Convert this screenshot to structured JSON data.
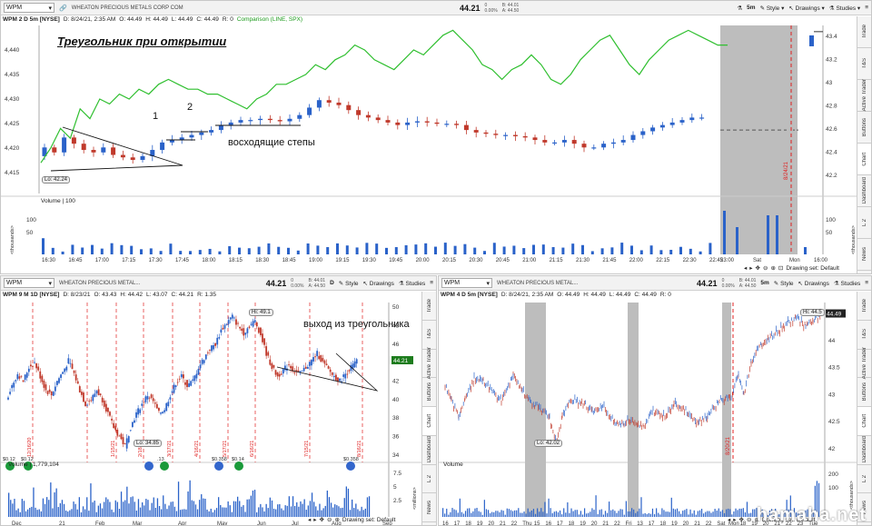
{
  "top": {
    "symbol": "WPM",
    "company": "WHEATON PRECIOUS METALS CORP COM",
    "price": "44.21",
    "change": "0",
    "change_pct": "0.00%",
    "bid": "B: 44.01",
    "ask": "A: 44.50",
    "info": {
      "title": "WPM 2 D 5m [NYSE]",
      "date": "D: 8/24/21, 2:35 AM",
      "open": "O: 44.49",
      "high": "H: 44.49",
      "low": "L: 44.49",
      "close": "C: 44.49",
      "range": "R: 0"
    },
    "comparison": "Comparison (LINE, SPX)",
    "interval": "5m",
    "style_label": "Style",
    "drawings_label": "Drawings",
    "studies_label": "Studies",
    "annotation_title": "Треугольник при открытии",
    "annotation_1": "1",
    "annotation_2": "2",
    "annotation_steps": "восходящие степы",
    "lo_label": "Lo: 42.24",
    "volume_label": "Volume",
    "volume_value": "100",
    "drawing_set": "Drawing set: Default",
    "date_marker": "8/24/21",
    "left_axis": [
      "4,440",
      "4,435",
      "4,430",
      "4,425",
      "4,420",
      "4,415"
    ],
    "right_axis": [
      "43.4",
      "43.2",
      "43",
      "42.8",
      "42.6",
      "42.4",
      "42.2"
    ],
    "vol_axis": [
      "100",
      "50"
    ],
    "thousands": "<thousands>",
    "time_axis": [
      "16:30",
      "16:45",
      "17:00",
      "17:15",
      "17:30",
      "17:45",
      "18:00",
      "18:15",
      "18:30",
      "18:45",
      "19:00",
      "19:15",
      "19:30",
      "19:45",
      "20:00",
      "20:15",
      "20:30",
      "20:45",
      "21:00",
      "21:15",
      "21:30",
      "21:45",
      "22:00",
      "22:15",
      "22:30",
      "22:45",
      "23:00",
      "Sat",
      "Mon",
      "16:00"
    ],
    "side_tabs": [
      "Trade",
      "T&S",
      "Active Trader",
      "Buttons",
      "Chart",
      "Dashboard",
      "L 2",
      "News"
    ]
  },
  "bottom_left": {
    "symbol": "WPM",
    "company": "WHEATON PRECIOUS METAL...",
    "price": "44.21",
    "change": "0",
    "change_pct": "0.00%",
    "bid": "B: 44.01",
    "ask": "A: 44.50",
    "interval": "D",
    "style_label": "Style",
    "drawings_label": "Drawings",
    "studies_label": "Studies",
    "info": {
      "title": "WPM 9 M 1D [NYSE]",
      "date": "D: 8/23/21",
      "open": "O: 43.43",
      "high": "H: 44.42",
      "low": "L: 43.07",
      "close": "C: 44.21",
      "range": "R: 1.35"
    },
    "annotation_exit": "выход из треугольника",
    "hi_label": "Hi: 49.1",
    "lo_label": "Lo: 34.85",
    "price_tag": "44.21",
    "volume_label": "Volume",
    "volume_value": "1,779,104",
    "drawing_set": "Drawing set: Default",
    "dividends": [
      "$0.12",
      "$0.12",
      ".13",
      "$0.358",
      "$0.14",
      "$0.358"
    ],
    "right_axis": [
      "50",
      "48",
      "46",
      "44",
      "42",
      "40",
      "38",
      "36",
      "34"
    ],
    "vol_axis": [
      "7.5",
      "5",
      "2.5"
    ],
    "millions": "<millions>",
    "time_axis": [
      "Dec",
      "21",
      "Feb",
      "Mar",
      "Apr",
      "May",
      "Jun",
      "Jul",
      "Aug",
      "Sep"
    ],
    "date_markers": [
      "12/16/20",
      "1/15/21",
      "2/18/21",
      "3/17/21",
      "4/16/21",
      "5/17/21",
      "6/16/21",
      "7/15/21",
      "8/16/21"
    ],
    "side_tabs": [
      "Trade",
      "T&S",
      "Active Trader",
      "Buttons",
      "Chart",
      "Dashboard",
      "L 2",
      "News"
    ]
  },
  "bottom_right": {
    "symbol": "WPM",
    "company": "WHEATON PRECIOUS METAL...",
    "price": "44.21",
    "change": "0",
    "change_pct": "0.00%",
    "bid": "B: 44.01",
    "ask": "A: 44.50",
    "interval": "5m",
    "style_label": "Style",
    "drawings_label": "Drawings",
    "studies_label": "Studies",
    "info": {
      "title": "WPM 4 D 5m [NYSE]",
      "date": "D: 8/24/21, 2:35 AM",
      "open": "O: 44.49",
      "high": "H: 44.49",
      "low": "L: 44.49",
      "close": "C: 44.49",
      "range": "R: 0"
    },
    "hi_label": "Hi: 44.5",
    "lo_label": "Lo: 42.02",
    "price_tag": "44.49",
    "volume_label": "Volume",
    "drawing_set": "Drawing set: Default",
    "date_marker": "8/20/21",
    "right_axis": [
      "44.5",
      "44",
      "43.5",
      "43",
      "42.5",
      "42"
    ],
    "vol_axis": [
      "200",
      "100"
    ],
    "thousands": "<thousands>",
    "time_axis": [
      "16",
      "17",
      "18",
      "19",
      "20",
      "21",
      "22",
      "Thu",
      "15",
      "16",
      "17",
      "18",
      "19",
      "20",
      "21",
      "22",
      "Fri",
      "13",
      "17",
      "18",
      "19",
      "20",
      "21",
      "22",
      "Sat",
      "Mon",
      "18",
      "19",
      "20",
      "21",
      "22",
      "23",
      "Tue"
    ],
    "side_tabs": [
      "Trade",
      "T&S",
      "Active Trader",
      "Buttons",
      "Chart",
      "Dashboard",
      "L 2",
      "News"
    ]
  },
  "watermark": "hamaha.net",
  "colors": {
    "up": "#2a62c9",
    "down": "#c0392b",
    "spx": "#2fbf2f",
    "volume": "#2a62c9",
    "session_gray": "#bdbdbd",
    "marker_red": "#e02020"
  }
}
